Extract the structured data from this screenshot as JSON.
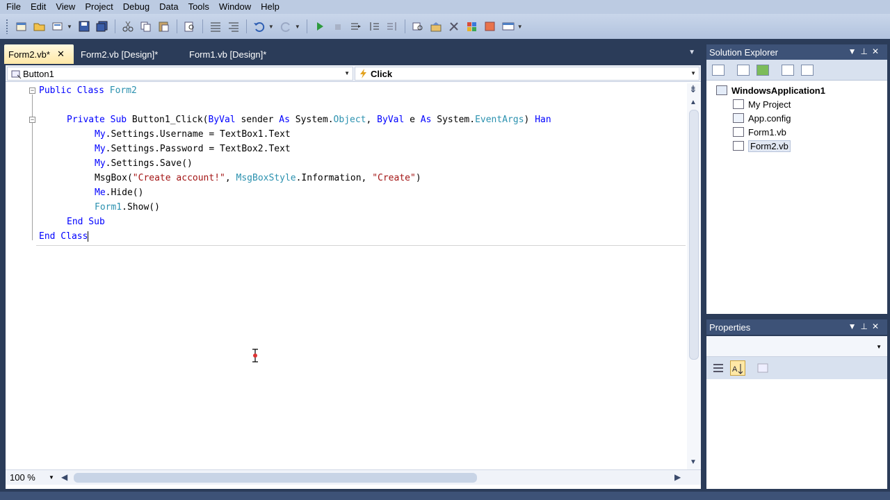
{
  "menu": [
    "File",
    "Edit",
    "View",
    "Project",
    "Debug",
    "Data",
    "Tools",
    "Window",
    "Help"
  ],
  "toolbar": {
    "icons": [
      "new-project-icon",
      "open-file-icon",
      "add-item-icon",
      "save-icon",
      "save-all-icon",
      "cut-icon",
      "copy-icon",
      "paste-icon",
      "find-icon",
      "comment-icon",
      "uncomment-icon",
      "undo-icon",
      "redo-icon",
      "start-debugging-icon",
      "stop-icon",
      "step-icon",
      "solution-explorer-icon",
      "properties-icon",
      "object-browser-icon",
      "toolbox-icon",
      "start-page-icon"
    ]
  },
  "tabs": [
    {
      "label": "Form2.vb*",
      "active": true
    },
    {
      "label": "Form2.vb [Design]*",
      "active": false
    },
    {
      "label": "Form1.vb [Design]*",
      "active": false
    }
  ],
  "nav": {
    "object": "Button1",
    "event": "Click"
  },
  "code": {
    "line1_kw": "Public Class",
    "line1_name": "Form2",
    "line3": {
      "kw1": "Private Sub",
      "name": " Button1_Click(",
      "kw2": "ByVal",
      "p1": " sender ",
      "kw3": "As",
      "p2": " System.",
      "ty1": "Object",
      "p3": ", ",
      "kw4": "ByVal",
      "p4": " e ",
      "kw5": "As",
      "p5": " System.",
      "ty2": "EventArgs",
      "p6": ") ",
      "kw6": "Han"
    },
    "line4": {
      "kw": "My",
      "rest": ".Settings.Username = TextBox1.Text"
    },
    "line5": {
      "kw": "My",
      "rest": ".Settings.Password = TextBox2.Text"
    },
    "line6": {
      "kw": "My",
      "rest": ".Settings.Save()"
    },
    "line7": {
      "a": "MsgBox(",
      "s1": "\"Create account!\"",
      "b": ", ",
      "ty": "MsgBoxStyle",
      "c": ".Information, ",
      "s2": "\"Create\"",
      "d": ")"
    },
    "line8": {
      "kw": "Me",
      "rest": ".Hide()"
    },
    "line9": {
      "ty": "Form1",
      "rest": ".Show()"
    },
    "line10": "End Sub",
    "line11": "End Class"
  },
  "zoom": "100 %",
  "solution_explorer": {
    "title": "Solution Explorer",
    "root": "WindowsApplication1",
    "items": [
      "My Project",
      "App.config",
      "Form1.vb",
      "Form2.vb"
    ],
    "selected": "Form2.vb"
  },
  "properties": {
    "title": "Properties"
  },
  "colors": {
    "keyword": "#0000ff",
    "type": "#2b91af",
    "string": "#a31515",
    "chrome": "#2b3c59",
    "tab_active": "#ffe8a6"
  }
}
